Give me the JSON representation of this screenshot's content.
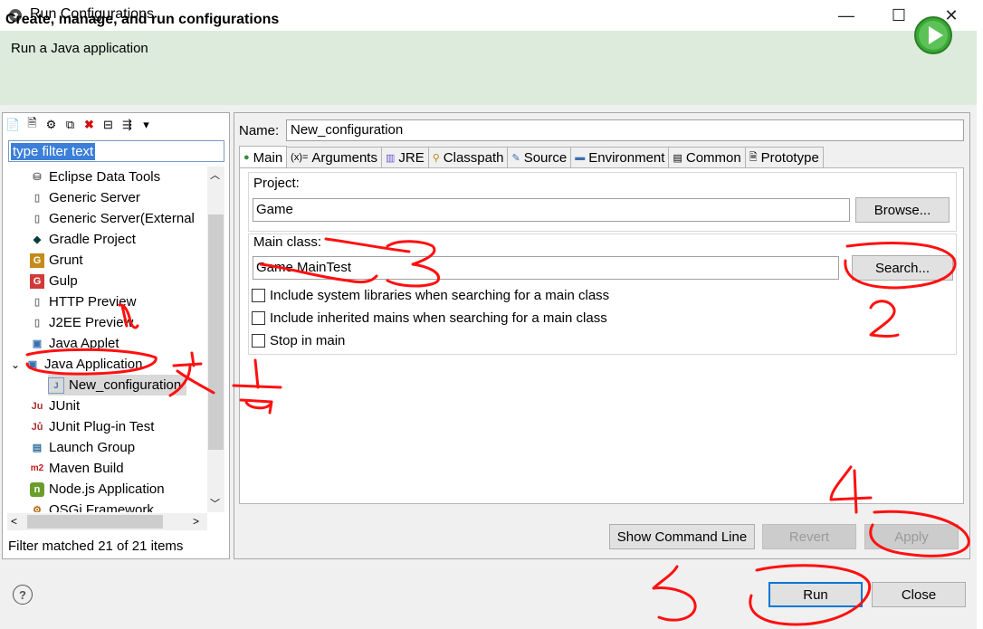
{
  "window": {
    "title": "Run Configurations",
    "minimize": "—",
    "maximize": "☐",
    "close": "✕"
  },
  "header": {
    "title": "Create, manage, and run configurations",
    "subtitle": "Run a Java application"
  },
  "filter": {
    "value": "type filter text"
  },
  "tree": {
    "items": [
      {
        "label": "Eclipse Data Tools",
        "icon": "database-icon"
      },
      {
        "label": "Generic Server",
        "icon": "server-icon"
      },
      {
        "label": "Generic Server(External",
        "icon": "server-icon"
      },
      {
        "label": "Gradle Project",
        "icon": "gradle-icon"
      },
      {
        "label": "Grunt",
        "icon": "grunt-icon"
      },
      {
        "label": "Gulp",
        "icon": "gulp-icon"
      },
      {
        "label": "HTTP Preview",
        "icon": "server-icon"
      },
      {
        "label": "J2EE Preview",
        "icon": "server-icon"
      },
      {
        "label": "Java Applet",
        "icon": "applet-icon"
      },
      {
        "label": "Java Application",
        "icon": "java-app-icon"
      },
      {
        "label": "New_configuration",
        "icon": "java-config-icon"
      },
      {
        "label": "JUnit",
        "icon": "junit-icon"
      },
      {
        "label": "JUnit Plug-in Test",
        "icon": "junit-plugin-icon"
      },
      {
        "label": "Launch Group",
        "icon": "launch-group-icon"
      },
      {
        "label": "Maven Build",
        "icon": "maven-icon"
      },
      {
        "label": "Node.js Application",
        "icon": "nodejs-icon"
      },
      {
        "label": "OSGi Framework",
        "icon": "osgi-icon"
      }
    ],
    "status": "Filter matched 21 of 21 items"
  },
  "config": {
    "name_label": "Name:",
    "name_value": "New_configuration",
    "tabs": [
      "Main",
      "Arguments",
      "JRE",
      "Classpath",
      "Source",
      "Environment",
      "Common",
      "Prototype"
    ],
    "project_label": "Project:",
    "project_value": "Game",
    "browse_label": "Browse...",
    "main_class_label": "Main class:",
    "main_class_value": "Game.MainTest",
    "search_label": "Search...",
    "checkboxes": [
      "Include system libraries when searching for a main class",
      "Include inherited mains when searching for a main class",
      "Stop in main"
    ]
  },
  "buttons": {
    "show_command_line": "Show Command Line",
    "revert": "Revert",
    "apply": "Apply",
    "run": "Run",
    "close": "Close"
  },
  "colors": {
    "banner": "#dcebdc",
    "selection": "#3c7fd9",
    "annotation": "#ff0000"
  }
}
